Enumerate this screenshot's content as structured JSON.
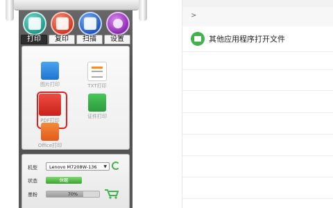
{
  "left_panel": {
    "top_icons": [
      {
        "name": "print-icon"
      },
      {
        "name": "copy-icon"
      },
      {
        "name": "scan-icon"
      },
      {
        "name": "settings-icon"
      }
    ],
    "tabs": [
      {
        "label": "打印",
        "active": true
      },
      {
        "label": "复印",
        "active": false
      },
      {
        "label": "扫描",
        "active": false
      },
      {
        "label": "设置",
        "active": false
      }
    ],
    "apps": [
      {
        "label": "图片打印",
        "icon": "image-icon"
      },
      {
        "label": "TXT打印",
        "icon": "text-document-icon"
      },
      {
        "label": "PDF打印",
        "icon": "pdf-icon",
        "selected": true
      },
      {
        "label": "证件打印",
        "icon": "id-card-icon"
      },
      {
        "label": "Office打印",
        "icon": "office-icon"
      }
    ],
    "info": {
      "model_label": "机型",
      "model_value": "Lenovo M7208W-136",
      "status_label": "状态",
      "status_value": "休眠",
      "toner_label": "墨粉",
      "toner_value": "70%",
      "toner_fraction": 0.7
    }
  },
  "right_panel": {
    "chevron": ">",
    "app_item_label": "其他应用程序打开文件"
  },
  "colors": {
    "status_green": "#3aa32c",
    "selection_red": "#e51d1d",
    "app_icon_green": "#3fb24b"
  }
}
